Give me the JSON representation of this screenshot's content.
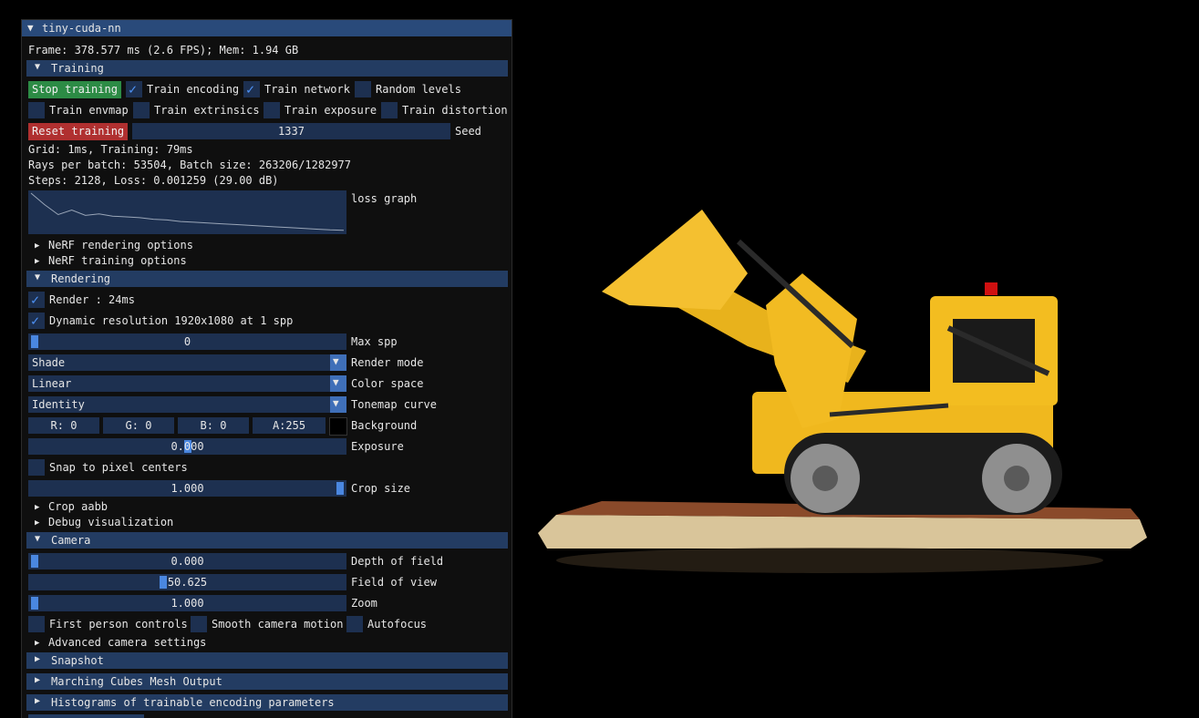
{
  "window": {
    "title": "tiny-cuda-nn",
    "collapse_icon": "triangle-down-icon"
  },
  "stats": {
    "frame": "Frame: 378.577 ms (2.6 FPS); Mem: 1.94 GB",
    "grid": "Grid: 1ms, Training: 79ms",
    "rays": "Rays per batch: 53504, Batch size: 263206/1282977",
    "steps": "Steps: 2128, Loss: 0.001259 (29.00 dB)"
  },
  "training": {
    "header": "Training",
    "stop_button": "Stop training",
    "reset_button": "Reset training",
    "train_encoding": "Train encoding",
    "train_network": "Train network",
    "random_levels": "Random levels",
    "train_envmap": "Train envmap",
    "train_extrinsics": "Train extrinsics",
    "train_exposure": "Train exposure",
    "train_distortion": "Train distortion",
    "seed_value": "1337",
    "seed_label": "Seed",
    "loss_graph_label": "loss graph",
    "loss_values": [
      0.05,
      0.035,
      0.022,
      0.028,
      0.021,
      0.023,
      0.02,
      0.019,
      0.018,
      0.016,
      0.015,
      0.013,
      0.012,
      0.011,
      0.01,
      0.009,
      0.008,
      0.007,
      0.006,
      0.005,
      0.004,
      0.003,
      0.002,
      0.0015
    ],
    "nerf_rendering_options": "NeRF rendering options",
    "nerf_training_options": "NeRF training options"
  },
  "rendering": {
    "header": "Rendering",
    "render_label": "Render : 24ms",
    "dynamic_resolution": "Dynamic resolution 1920x1080 at 1 spp",
    "max_spp_value": "0",
    "max_spp_label": "Max spp",
    "render_mode_value": "Shade",
    "render_mode_label": "Render mode",
    "color_space_value": "Linear",
    "color_space_label": "Color space",
    "tonemap_value": "Identity",
    "tonemap_label": "Tonemap curve",
    "bg_r": "R:  0",
    "bg_g": "G:  0",
    "bg_b": "B:  0",
    "bg_a": "A:255",
    "background_label": "Background",
    "exposure_value": "0.000",
    "exposure_label": "Exposure",
    "snap_label": "Snap to pixel centers",
    "crop_value": "1.000",
    "crop_label": "Crop size",
    "crop_aabb": "Crop aabb",
    "debug_vis": "Debug visualization"
  },
  "camera": {
    "header": "Camera",
    "dof_value": "0.000",
    "dof_label": "Depth of field",
    "fov_value": "50.625",
    "fov_label": "Field of view",
    "zoom_value": "1.000",
    "zoom_label": "Zoom",
    "first_person": "First person controls",
    "smooth_motion": "Smooth camera motion",
    "autofocus": "Autofocus",
    "advanced": "Advanced camera settings"
  },
  "sections": {
    "snapshot": "Snapshot",
    "marching_cubes": "Marching Cubes Mesh Output",
    "histograms": "Histograms of trainable encoding parameters"
  },
  "colors": {
    "accent": "#4a87e0",
    "header": "#233c62",
    "title": "#294a7a",
    "field": "#1d3050",
    "green": "#2c8b45",
    "red": "#b03030"
  }
}
